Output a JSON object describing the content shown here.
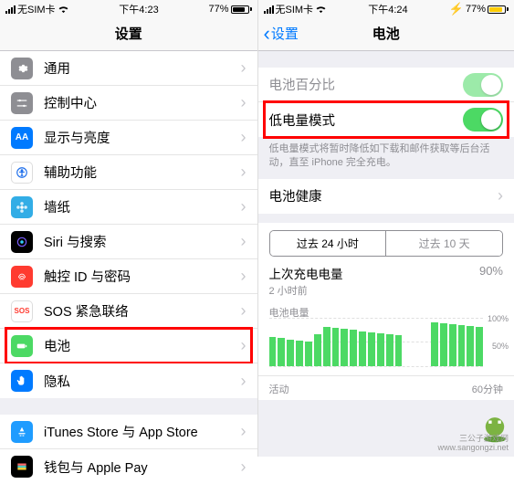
{
  "left": {
    "status": {
      "carrier": "无SIM卡",
      "time": "下午4:23",
      "battery_pct": "77%",
      "battery_fill": 77
    },
    "nav_title": "设置",
    "groups": [
      {
        "items": [
          {
            "key": "general",
            "icon": "gear",
            "bg": "bg-gray",
            "label": "通用"
          },
          {
            "key": "control",
            "icon": "sliders",
            "bg": "bg-gray",
            "label": "控制中心"
          },
          {
            "key": "display",
            "icon": "AA",
            "bg": "bg-aa",
            "label": "显示与亮度"
          },
          {
            "key": "accessibility",
            "icon": "touch",
            "bg": "bg-touch",
            "label": "辅助功能"
          },
          {
            "key": "wallpaper",
            "icon": "flower",
            "bg": "bg-cyan",
            "label": "墙纸"
          },
          {
            "key": "siri",
            "icon": "siri",
            "bg": "bg-black",
            "label": "Siri 与搜索"
          },
          {
            "key": "touchid",
            "icon": "finger",
            "bg": "bg-red",
            "label": "触控 ID 与密码"
          },
          {
            "key": "sos",
            "icon": "SOS",
            "bg": "bg-white",
            "label": "SOS 紧急联络"
          },
          {
            "key": "battery",
            "icon": "batt",
            "bg": "bg-green",
            "label": "电池",
            "highlighted": true
          },
          {
            "key": "privacy",
            "icon": "hand",
            "bg": "bg-bluePriv",
            "label": "隐私"
          }
        ]
      },
      {
        "items": [
          {
            "key": "itunes",
            "icon": "A",
            "bg": "bg-blueStore",
            "label": "iTunes Store 与 App Store"
          },
          {
            "key": "wallet",
            "icon": "wallet",
            "bg": "bg-dark",
            "label": "钱包与 Apple Pay"
          }
        ]
      }
    ]
  },
  "right": {
    "status": {
      "carrier": "无SIM卡",
      "time": "下午4:24",
      "battery_pct": "77%",
      "battery_fill": 77
    },
    "back_label": "设置",
    "nav_title": "电池",
    "row_percent": "电池百分比",
    "row_lowpower": "低电量模式",
    "footnote": "低电量模式将暂时降低如下载和邮件获取等后台活动，直至 iPhone 完全充电。",
    "row_health": "电池健康",
    "seg": {
      "tab24": "过去 24 小时",
      "tab10": "过去 10 天"
    },
    "last_charge_title": "上次充电电量",
    "last_charge_sub": "2 小时前",
    "last_charge_pct": "90%",
    "chart_label": "电池电量",
    "y100": "100%",
    "y50": "50%",
    "activity_label": "活动",
    "activity_right": "60分钟"
  },
  "chart_data": {
    "type": "bar",
    "title": "电池电量",
    "ylabel": "%",
    "ylim": [
      0,
      100
    ],
    "categories_note": "过去 24 小时（每小时一条）",
    "values": [
      60,
      58,
      55,
      52,
      50,
      65,
      80,
      78,
      76,
      74,
      72,
      70,
      68,
      66,
      64,
      null,
      null,
      null,
      90,
      88,
      86,
      84,
      82,
      80
    ]
  },
  "watermark": {
    "site_cn": "三公子游戏网",
    "site_url": "www.sangongzi.net"
  }
}
